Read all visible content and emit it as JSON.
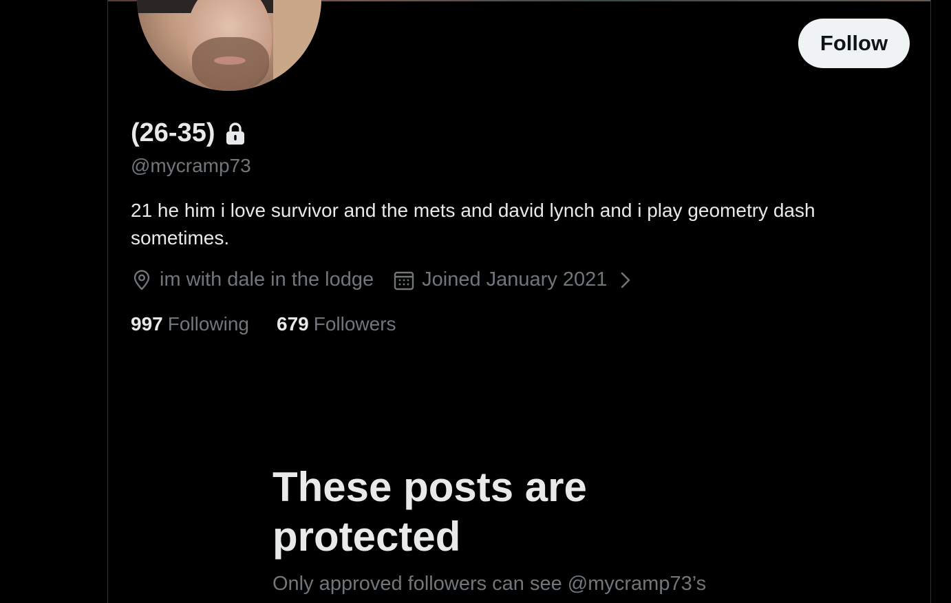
{
  "profile": {
    "display_name": "(26-35)",
    "handle": "@mycramp73",
    "bio": "21 he him i love survivor and the mets and david lynch and i play geometry dash sometimes.",
    "location": "im with dale in the lodge",
    "joined": "Joined January 2021",
    "protected_icon": "lock-icon"
  },
  "actions": {
    "follow_label": "Follow"
  },
  "stats": {
    "following_count": "997",
    "following_label": "Following",
    "followers_count": "679",
    "followers_label": "Followers"
  },
  "protected_notice": {
    "title": "These posts are protected",
    "subtitle": "Only approved followers can see @mycramp73’s"
  },
  "colors": {
    "background": "#000000",
    "primary_text": "#e7e9ea",
    "secondary_text": "#71767b",
    "button_bg": "#eff3f4",
    "button_text": "#0f1419"
  }
}
